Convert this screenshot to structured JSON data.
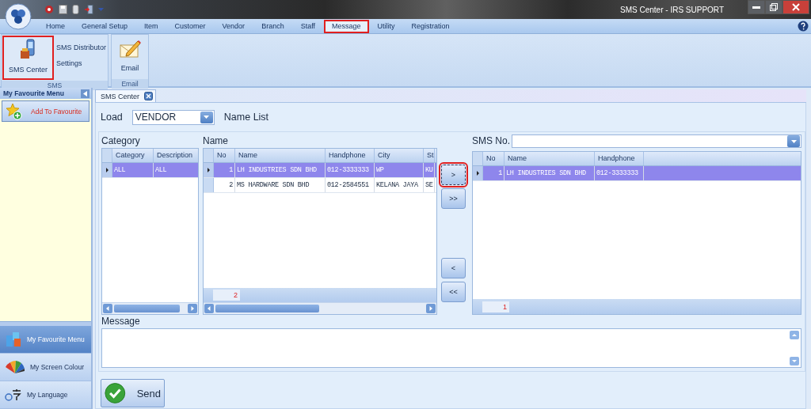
{
  "window": {
    "title": "SMS Center - IRS SUPPORT"
  },
  "ribbon": {
    "tabs": [
      {
        "label": "Home",
        "selected": false
      },
      {
        "label": "General Setup",
        "selected": false
      },
      {
        "label": "Item",
        "selected": false
      },
      {
        "label": "Customer",
        "selected": false
      },
      {
        "label": "Vendor",
        "selected": false
      },
      {
        "label": "Branch",
        "selected": false
      },
      {
        "label": "Staff",
        "selected": false
      },
      {
        "label": "Message",
        "selected": true
      },
      {
        "label": "Utility",
        "selected": false
      },
      {
        "label": "Registration",
        "selected": false
      }
    ],
    "groups": [
      {
        "label": "SMS",
        "buttons": [
          {
            "label": "SMS Center",
            "kind": "large",
            "selected": true
          },
          {
            "label": "SMS Distributor",
            "kind": "small",
            "selected": false
          },
          {
            "label": "Settings",
            "kind": "small",
            "selected": false
          }
        ]
      },
      {
        "label": "Email",
        "buttons": [
          {
            "label": "Email",
            "kind": "large",
            "selected": false
          }
        ]
      }
    ]
  },
  "sidebar": {
    "title": "My Favourite Menu",
    "add_button": "Add To Favourite",
    "nav": [
      {
        "label": "My Favourite Menu",
        "selected": true
      },
      {
        "label": "My Screen Colour",
        "selected": false
      },
      {
        "label": "My Language",
        "selected": false
      }
    ]
  },
  "document_tab": {
    "label": "SMS Center"
  },
  "load": {
    "label": "Load",
    "value": "VENDOR",
    "note": "Name List"
  },
  "category": {
    "title": "Category",
    "columns": [
      "Category",
      "Description"
    ],
    "rows": [
      {
        "cells": [
          "ALL",
          "ALL"
        ],
        "selected": true
      }
    ]
  },
  "names": {
    "title": "Name",
    "columns": [
      "No",
      "Name",
      "Handphone",
      "City",
      "St"
    ],
    "rows": [
      {
        "cells": [
          "1",
          "LH INDUSTRIES SDN BHD",
          "012-3333333",
          "WP",
          "KU"
        ],
        "selected": true
      },
      {
        "cells": [
          "2",
          "MS HARDWARE SDN BHD",
          "012-2584551",
          "KELANA JAYA",
          "SE"
        ],
        "selected": false
      }
    ],
    "count": "2"
  },
  "move_buttons": [
    {
      "label": ">",
      "selected": true
    },
    {
      "label": ">>",
      "selected": false
    },
    {
      "label": "<",
      "selected": false
    },
    {
      "label": "<<",
      "selected": false
    }
  ],
  "sms": {
    "label": "SMS No.",
    "columns": [
      "No",
      "Name",
      "Handphone"
    ],
    "rows": [
      {
        "cells": [
          "1",
          "LH INDUSTRIES SDN BHD",
          "012-3333333"
        ],
        "selected": true
      }
    ],
    "count": "1"
  },
  "message": {
    "label": "Message"
  },
  "send_button": {
    "label": "Send"
  }
}
